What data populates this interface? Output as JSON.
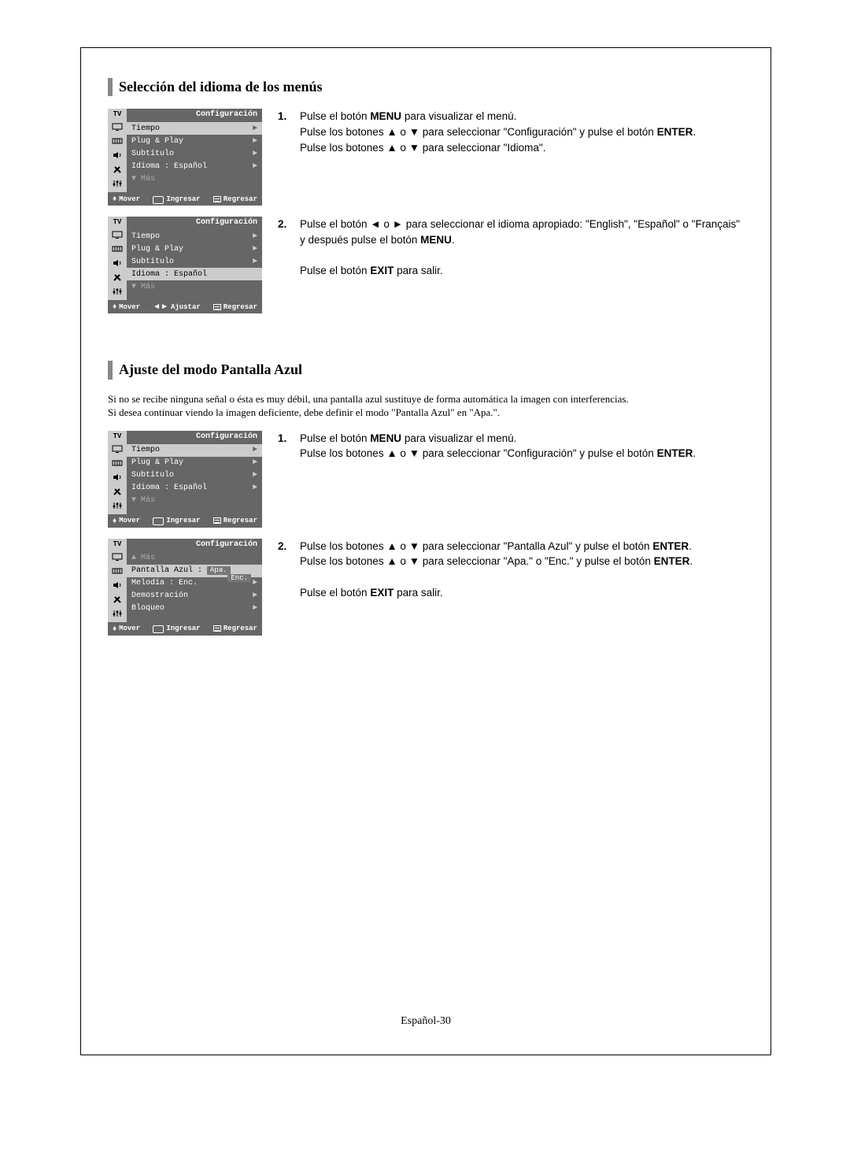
{
  "page_number": "Español-30",
  "section1": {
    "title": "Selección del idioma de los menús"
  },
  "section2": {
    "title": "Ajuste del modo Pantalla Azul",
    "intro_line1": "Si no se recibe ninguna señal o ésta es muy débil, una pantalla azul sustituye de forma automática la imagen con interferencias.",
    "intro_line2": "Si desea continuar viendo la imagen deficiente, debe definir el modo \"Pantalla Azul\" en \"Apa.\"."
  },
  "osd": {
    "tv_label": "TV",
    "title": "Configuración",
    "items": {
      "tiempo": "Tiempo",
      "plug": "Plug & Play",
      "subtitulo": "Subtítulo",
      "idioma": "Idioma",
      "idioma_value": "Español",
      "mas_down": "Más",
      "mas_up": "Más",
      "pantalla": "Pantalla Azul :",
      "pantalla_value": "Apa.",
      "enc": "Enc.",
      "melodia": "Melodía",
      "melodia_value": "Enc.",
      "demo": "Demostración",
      "bloqueo": "Bloqueo"
    },
    "footer": {
      "mover": "Mover",
      "ingresar": "Ingresar",
      "ajustar": "Ajustar",
      "regresar": "Regresar"
    }
  },
  "steps_a": {
    "s1_l1a": "Pulse el botón ",
    "s1_l1b": "MENU",
    "s1_l1c": " para visualizar el menú.",
    "s1_l2": "Pulse los botones ▲ o ▼ para seleccionar \"Configuración\" y pulse el botón ",
    "s1_l2b": "ENTER",
    "s1_l3": "Pulse los botones ▲ o ▼ para seleccionar \"Idioma\".",
    "s2_l1": "Pulse el botón ◄ o ► para seleccionar el idioma apropiado: \"English\", \"Español\" o \"Français\" y después pulse el botón ",
    "s2_l1b": "MENU",
    "s2_l2a": "Pulse el botón ",
    "s2_l2b": "EXIT",
    "s2_l2c": " para salir."
  },
  "steps_b": {
    "s1_l1a": "Pulse el botón ",
    "s1_l1b": "MENU",
    "s1_l1c": " para visualizar el menú.",
    "s1_l2": "Pulse los botones ▲ o ▼ para seleccionar \"Configuración\" y pulse el botón ",
    "s1_l2b": "ENTER",
    "s2_l1": "Pulse los botones ▲ o ▼ para seleccionar \"Pantalla Azul\" y pulse el botón ",
    "s2_l1b": "ENTER",
    "s2_l2": "Pulse los botones ▲ o ▼ para seleccionar \"Apa.\" o \"Enc.\" y pulse el botón ",
    "s2_l2b": "ENTER",
    "s2_l3a": "Pulse el botón ",
    "s2_l3b": "EXIT",
    "s2_l3c": " para salir."
  },
  "nums": {
    "one": "1.",
    "two": "2."
  }
}
